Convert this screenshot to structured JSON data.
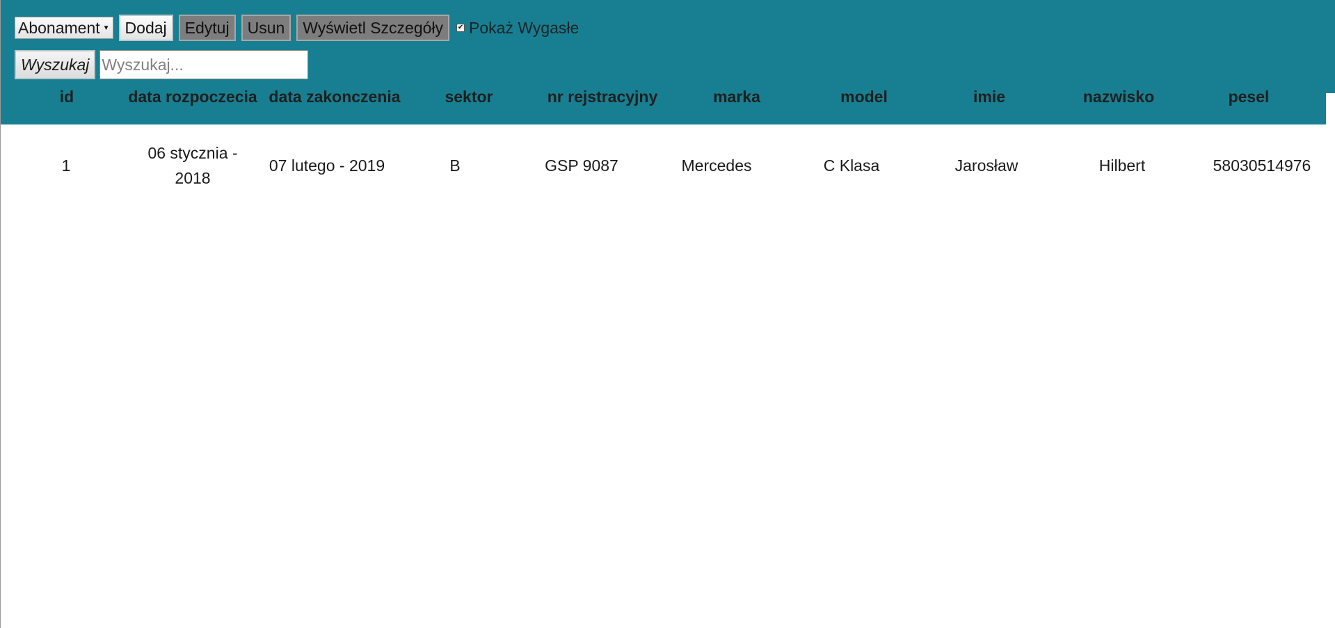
{
  "toolbar": {
    "dropdown_value": "Abonament",
    "add_label": "Dodaj",
    "edit_label": "Edytuj",
    "delete_label": "Usun",
    "details_label": "Wyświetl Szczegóły",
    "show_expired_label": "Pokaż Wygasłe",
    "show_expired_checked": true
  },
  "search": {
    "button_label": "Wyszukaj",
    "placeholder": "Wyszukaj...",
    "value": ""
  },
  "colors": {
    "header_bg": "#177f91",
    "gray_button": "#7d7d7d"
  },
  "table": {
    "columns": [
      "id",
      "data rozpoczecia",
      "data zakonczenia",
      "sektor",
      "nr rejstracyjny",
      "marka",
      "model",
      "imie",
      "nazwisko",
      "pesel"
    ],
    "rows": [
      [
        "1",
        "06 stycznia - 2018",
        "07 lutego - 2019",
        "B",
        "GSP 9087",
        "Mercedes",
        "C Klasa",
        "Jarosław",
        "Hilbert",
        "58030514976"
      ]
    ]
  }
}
